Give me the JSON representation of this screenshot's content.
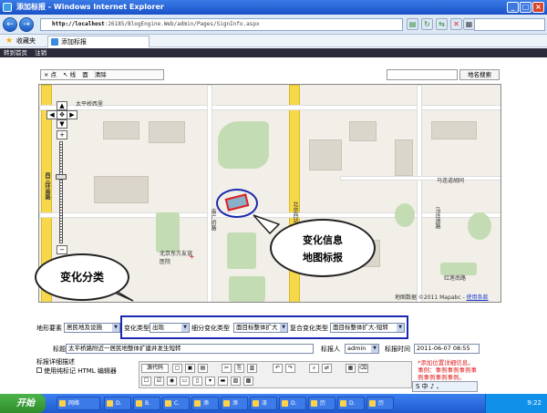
{
  "window": {
    "title": "添加标报 - Windows Internet Explorer"
  },
  "addressbar": {
    "url_host": "http://localhost",
    "url_path": ":26185/BlogEngine.Web/admin/Pages/SignInfo.aspx"
  },
  "favorites": {
    "label": "收藏夹",
    "tab_title": "添加标报"
  },
  "site_nav": {
    "items": [
      "转到首页",
      "注销"
    ]
  },
  "map_tools": {
    "items": [
      "× 点",
      "↖ 线",
      "面",
      "清除"
    ],
    "search_button": "地名搜索"
  },
  "map": {
    "labels": [
      "太平桥西里",
      "西三环南路",
      "北京东方友谊医院",
      "马连道胡同",
      "马连道路",
      "红莲南路",
      "北京西站",
      "南广桥路"
    ],
    "footer": "地图数据 ©2011 Mapabc - ",
    "footer_link": "使用条款"
  },
  "annotations": {
    "map_label_line1": "变化信息",
    "map_label_line2": "地图标报",
    "category_label": "变化分类"
  },
  "form": {
    "terrain_label": "地形要素",
    "terrain_value": "居民地及设施",
    "change_type_label": "变化类型",
    "change_type_value": "出现",
    "sub_change_label": "细分变化类型",
    "sub_change_value": "面目标整体扩大",
    "compound_label": "复合变化类型",
    "compound_value": "面目标整体扩大-短转",
    "title_label": "标题",
    "title_value": "太平桥路附近一居民地整体扩建并发生短转",
    "reporter_label": "标报人",
    "reporter_value": "admin",
    "time_label": "标报时间",
    "time_value": "2011-06-07 08:55",
    "desc_label": "标报详细描述",
    "html_editor_label": "使用纯标记 HTML 编辑器",
    "source_button": "源代码",
    "hint_line1": "*添加位置详细信息。",
    "hint_line2": "事例：事例事例事例事",
    "hint_line3": "例事例事例事例。"
  },
  "taskbar": {
    "start": "开始",
    "tasks": [
      "网络",
      "D.",
      "B.",
      "C.",
      "添",
      "添",
      "泽",
      "D.",
      "历",
      "D.",
      "历"
    ],
    "clock": "9:22"
  },
  "ime": {
    "label": "S 中 ♪ 、"
  }
}
